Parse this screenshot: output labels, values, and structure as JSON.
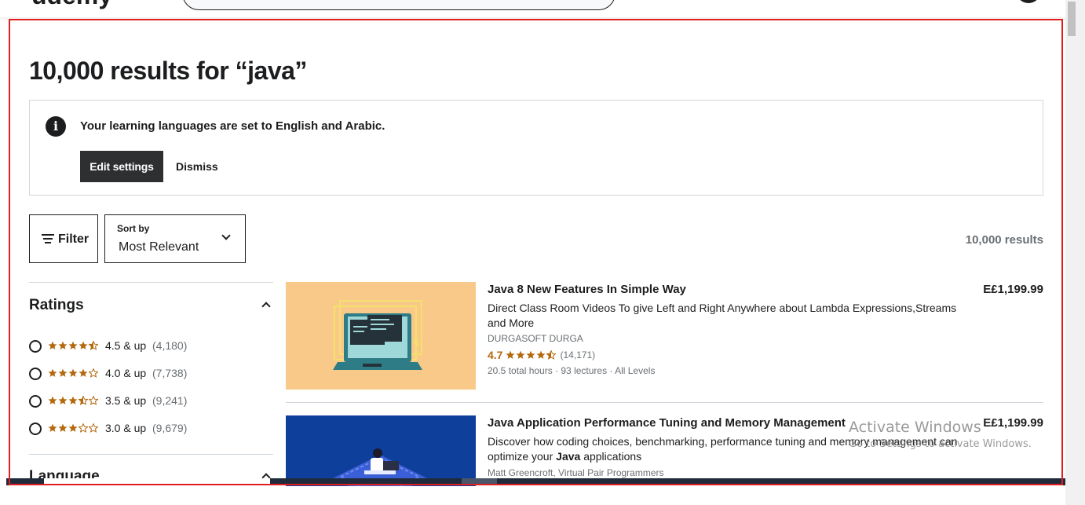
{
  "page": {
    "title": "10,000 results for “java”",
    "results_count": "10,000 results"
  },
  "alert": {
    "icon": "info-icon",
    "message": "Your learning languages are set to English and Arabic.",
    "edit_label": "Edit settings",
    "dismiss_label": "Dismiss"
  },
  "controls": {
    "filter_label": "Filter",
    "sort_caption": "Sort by",
    "sort_value": "Most Relevant"
  },
  "sidebar": {
    "ratings_heading": "Ratings",
    "ratings": [
      {
        "stars": 4.5,
        "label": "4.5 & up",
        "count": "(4,180)"
      },
      {
        "stars": 4.0,
        "label": "4.0 & up",
        "count": "(7,738)"
      },
      {
        "stars": 3.5,
        "label": "3.5 & up",
        "count": "(9,241)"
      },
      {
        "stars": 3.0,
        "label": "3.0 & up",
        "count": "(9,679)"
      }
    ],
    "language_heading": "Language"
  },
  "courses": [
    {
      "title": "Java 8 New Features In Simple Way",
      "description": "Direct Class Room Videos To give Left and Right Anywhere about Lambda Expressions,Streams and More",
      "author": "DURGASOFT DURGA",
      "rating": "4.7",
      "stars": 4.7,
      "rating_count": "(14,171)",
      "meta": "20.5 total hours · 93 lectures · All Levels",
      "price": "E£1,199.99"
    },
    {
      "title": "Java Application Performance Tuning and Memory Management",
      "description_pre": "Discover how coding choices, benchmarking, performance tuning and memory management can optimize your ",
      "description_bold": "Java",
      "description_post": " applications",
      "author": "Matt Greencroft, Virtual Pair Programmers",
      "price": "E£1,199.99"
    }
  ],
  "watermark": {
    "line1": "Activate Windows",
    "line2": "Go to Settings to activate Windows."
  },
  "colors": {
    "star": "#b4690e",
    "button_dark": "#2d2f31",
    "border": "#d1d7dc",
    "muted": "#6a6f73"
  }
}
